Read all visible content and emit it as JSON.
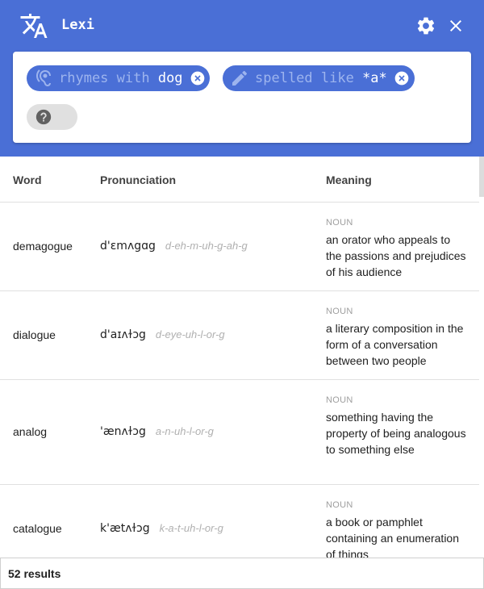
{
  "app": {
    "title": "Lexi"
  },
  "query": {
    "rhymes": {
      "key": "rhymes with ",
      "value": "dog"
    },
    "spelled": {
      "key": "spelled like ",
      "value": "*a*"
    }
  },
  "table": {
    "headers": {
      "word": "Word",
      "pronunciation": "Pronunciation",
      "meaning": "Meaning"
    },
    "rows": [
      {
        "word": "demagogue",
        "ipa": "d'ɛmʌgɑg",
        "phonetic": "d-eh-m-uh-g-ah-g",
        "pos": "NOUN",
        "definition": "an orator who appeals to the passions and prejudices of his audience"
      },
      {
        "word": "dialogue",
        "ipa": "d'aɪʌɫɔg",
        "phonetic": "d-eye-uh-l-or-g",
        "pos": "NOUN",
        "definition": "a literary composition in the form of a conversation between two people"
      },
      {
        "word": "analog",
        "ipa": "'ænʌɫɔg",
        "phonetic": "a-n-uh-l-or-g",
        "pos": "NOUN",
        "definition": "something having the property of being analogous to something else"
      },
      {
        "word": "catalogue",
        "ipa": "k'ætʌɫɔg",
        "phonetic": "k-a-t-uh-l-or-g",
        "pos": "NOUN",
        "definition": "a book or pamphlet containing an enumeration of things"
      }
    ]
  },
  "footer": {
    "results": "52 results"
  },
  "colors": {
    "primary": "#4a6fd6",
    "chip_key": "#9db4ee"
  },
  "icons": {
    "app": "translate-icon",
    "settings": "gear-icon",
    "close": "close-icon",
    "rhymes": "hearing-icon",
    "spelled": "pencil-icon",
    "help": "help-icon"
  }
}
